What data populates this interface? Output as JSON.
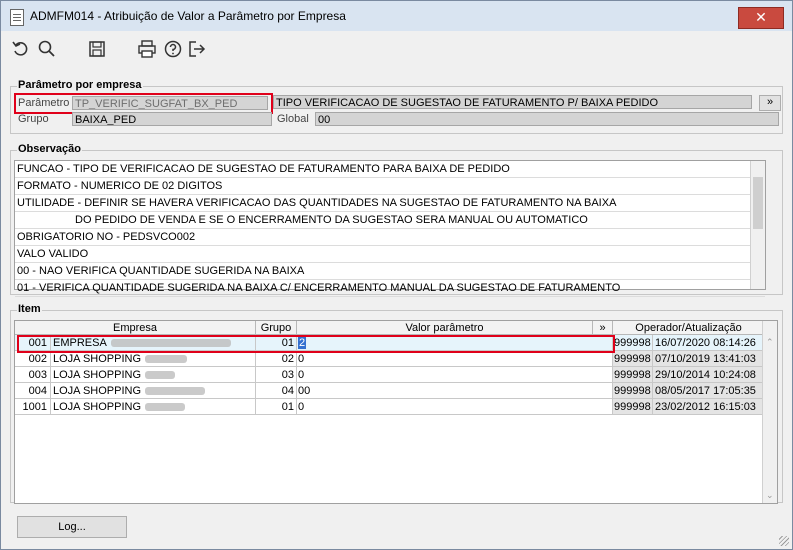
{
  "window": {
    "title": "ADMFM014 - Atribuição de Valor a Parâmetro por Empresa",
    "close_glyph": "✕"
  },
  "toolbar": {
    "icons": [
      "undo-icon",
      "search-icon",
      "save-icon",
      "print-icon",
      "help-icon",
      "exit-icon"
    ]
  },
  "param": {
    "section_title": "Parâmetro por empresa",
    "parametro_label": "Parâmetro",
    "parametro_value": "TP_VERIFIC_SUGFAT_BX_PED",
    "description": "TIPO VERIFICACAO DE SUGESTAO DE FATURAMENTO P/ BAIXA PEDIDO",
    "expand_label": "»",
    "grupo_label": "Grupo",
    "grupo_value": "BAIXA_PED",
    "global_label": "Global",
    "global_value": "00"
  },
  "observacao": {
    "section_title": "Observação",
    "lines": [
      "FUNCAO - TIPO DE VERIFICACAO DE SUGESTAO DE FATURAMENTO PARA BAIXA DE PEDIDO",
      "FORMATO - NUMERICO DE 02 DIGITOS",
      "UTILIDADE - DEFINIR SE HAVERA VERIFICACAO DAS QUANTIDADES NA SUGESTAO DE FATURAMENTO NA BAIXA",
      "DO PEDIDO DE VENDA E SE O ENCERRAMENTO DA SUGESTAO SERA MANUAL OU AUTOMATICO",
      "OBRIGATORIO NO - PEDSVCO002",
      "VALO VALIDO",
      "00 - NAO VERIFICA QUANTIDADE SUGERIDA NA BAIXA",
      "01 - VERIFICA QUANTIDADE SUGERIDA NA BAIXA C/ ENCERRAMENTO MANUAL DA SUGESTAO DE FATURAMENTO"
    ]
  },
  "item": {
    "section_title": "Item",
    "columns": {
      "empresa": "Empresa",
      "grupo": "Grupo",
      "valor": "Valor parâmetro",
      "expand": "»",
      "operador": "Operador/Atualização"
    },
    "rows": [
      {
        "code": "001",
        "empresa": "EMPRESA",
        "grupo": "01",
        "valor": "2",
        "operador": "999998",
        "data": "16/07/2020 08:14:26"
      },
      {
        "code": "002",
        "empresa": "LOJA SHOPPING",
        "grupo": "02",
        "valor": "0",
        "operador": "999998",
        "data": "07/10/2019 13:41:03"
      },
      {
        "code": "003",
        "empresa": "LOJA SHOPPING",
        "grupo": "03",
        "valor": "0",
        "operador": "999998",
        "data": "29/10/2014 10:24:08"
      },
      {
        "code": "004",
        "empresa": "LOJA SHOPPING",
        "grupo": "04",
        "valor": "00",
        "operador": "999998",
        "data": "08/05/2017 17:05:35"
      },
      {
        "code": "1001",
        "empresa": "LOJA SHOPPING",
        "grupo": "01",
        "valor": "0",
        "operador": "999998",
        "data": "23/02/2012 16:15:03"
      }
    ]
  },
  "footer": {
    "log_label": "Log..."
  }
}
